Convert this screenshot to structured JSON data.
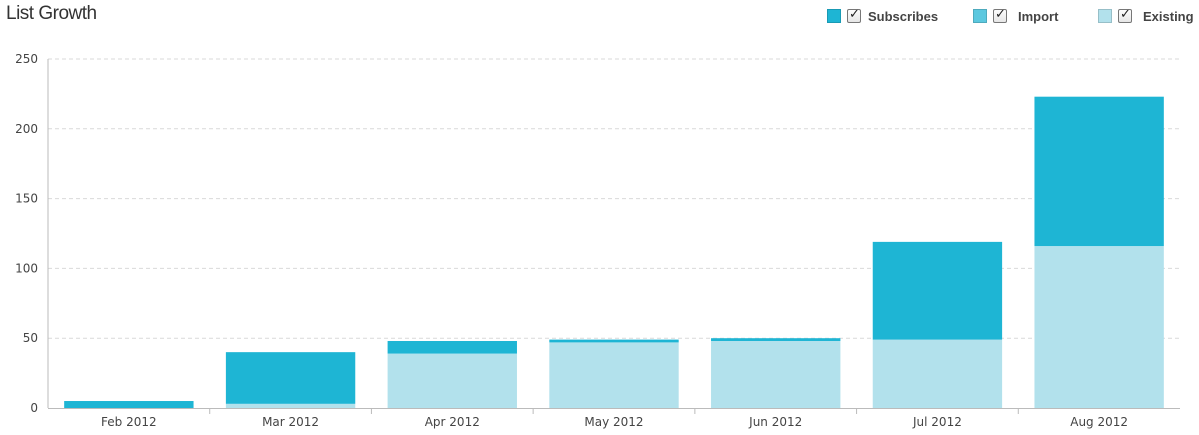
{
  "page": {
    "title": "List Growth"
  },
  "legend": [
    {
      "label": "Subscribes",
      "color": "#1eb5d4",
      "checked": true
    },
    {
      "label": "Import",
      "color": "#5cc8df",
      "checked": true
    },
    {
      "label": "Existing",
      "color": "#b2e1ec",
      "checked": true
    }
  ],
  "chart_data": {
    "type": "bar",
    "stacked": true,
    "title": "List Growth",
    "categories": [
      "Feb 2012",
      "Mar 2012",
      "Apr 2012",
      "May 2012",
      "Jun 2012",
      "Jul 2012",
      "Aug 2012"
    ],
    "series": [
      {
        "name": "Existing",
        "color": "#b2e1ec",
        "values": [
          0,
          3,
          39,
          47,
          48,
          49,
          116
        ]
      },
      {
        "name": "Import",
        "color": "#5cc8df",
        "values": [
          0,
          0,
          0,
          0,
          0,
          0,
          0
        ]
      },
      {
        "name": "Subscribes",
        "color": "#1eb5d4",
        "values": [
          5,
          37,
          9,
          2,
          2,
          70,
          107
        ]
      }
    ],
    "ylim": [
      0,
      250
    ],
    "yticks": [
      0,
      50,
      100,
      150,
      200,
      250
    ],
    "grid": true,
    "legend_position": "top-right",
    "xlabel": "",
    "ylabel": ""
  }
}
